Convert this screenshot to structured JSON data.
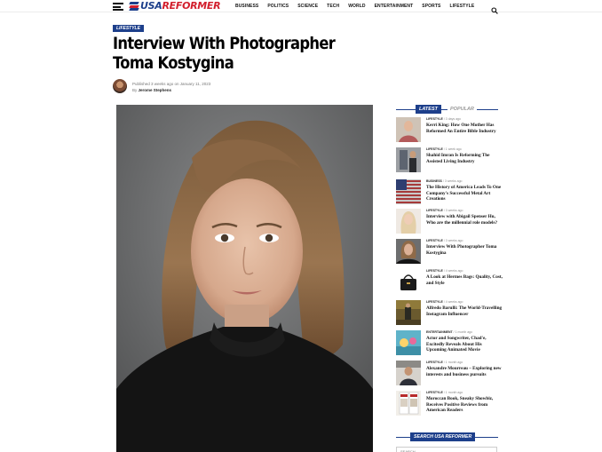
{
  "header": {
    "logo_usa": "USA",
    "logo_reformer": "REFORMER",
    "nav": [
      "BUSINESS",
      "POLITICS",
      "SCIENCE",
      "TECH",
      "WORLD",
      "ENTERTAINMENT",
      "SPORTS",
      "LIFESTYLE"
    ],
    "menu_icon": "hamburger-menu-icon",
    "search_icon": "search-icon"
  },
  "article": {
    "category": "LIFESTYLE",
    "title": "Interview With Photographer Toma Kostygina",
    "published": "Published 3 weeks ago on January 11, 2023",
    "by": "By",
    "author": "Jerome Stephens"
  },
  "sidebar": {
    "tab_latest": "LATEST",
    "tab_popular": "POPULAR",
    "items": [
      {
        "category": "LIFESTYLE",
        "age": "3 days ago",
        "title": "Kerri King: How One Mother Has Reformed An Entire Bible Industry"
      },
      {
        "category": "LIFESTYLE",
        "age": "1 week ago",
        "title": "Shahid Imran Is Reforming The Assisted Living Industry"
      },
      {
        "category": "BUSINESS",
        "age": "3 weeks ago",
        "title": "The History of America Leads To One Company's Successful Metal Art Creations"
      },
      {
        "category": "LIFESTYLE",
        "age": "3 weeks ago",
        "title": "Interview with Abigail Spenser Hu, Who are the millennial role models?"
      },
      {
        "category": "LIFESTYLE",
        "age": "3 weeks ago",
        "title": "Interview With Photographer Toma Kostygina"
      },
      {
        "category": "LIFESTYLE",
        "age": "4 weeks ago",
        "title": "A Look at Hermes Bags: Quality, Cost, and Style"
      },
      {
        "category": "LIFESTYLE",
        "age": "4 weeks ago",
        "title": "Alfredo Barulli: The World-Travelling Instagram Influencer"
      },
      {
        "category": "ENTERTAINMENT",
        "age": "1 month ago",
        "title": "Actor and Songwriter, Chad'e, Excitedly Reveals About His Upcoming Animated Movie"
      },
      {
        "category": "LIFESTYLE",
        "age": "1 month ago",
        "title": "Alexandre Mourreau – Exploring new interests and business pursuits"
      },
      {
        "category": "LIFESTYLE",
        "age": "1 month ago",
        "title": "Moroccan Book, Sneaky Showbiz, Receives Positive Reviews from American Readers"
      }
    ],
    "search_heading": "SEARCH USA REFORMER",
    "search_placeholder": "SEARCH"
  },
  "colors": {
    "brand_blue": "#1d3f8b",
    "brand_red": "#d21f2d"
  }
}
